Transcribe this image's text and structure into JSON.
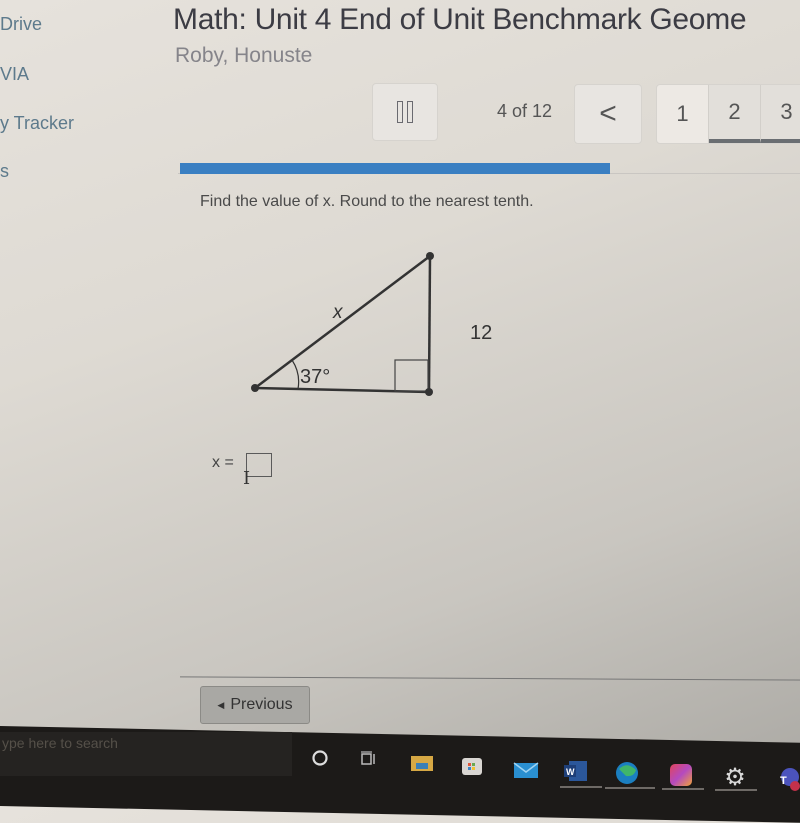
{
  "sidebar": {
    "items": [
      {
        "label": "Drive"
      },
      {
        "label": "VIA"
      },
      {
        "label": "y Tracker"
      },
      {
        "label": "s"
      }
    ]
  },
  "header": {
    "title": "Math: Unit 4 End of Unit Benchmark Geome",
    "student": "Roby, Honuste"
  },
  "toolbar": {
    "pause_icon": "pause-icon",
    "counter": "4 of 12",
    "prev_icon": "chevron-left-icon",
    "prev_glyph": "<",
    "pages": [
      "1",
      "2",
      "3"
    ],
    "current_page": "2"
  },
  "progress": {
    "fraction": 0.333,
    "current": 4,
    "total": 12
  },
  "question": {
    "prompt": "Find the value of x. Round to the nearest tenth.",
    "figure": {
      "hypotenuse_label": "x",
      "opposite_label": "12",
      "angle_label": "37°"
    },
    "answer_label": "x =",
    "answer_value": ""
  },
  "footer": {
    "previous_label": "Previous"
  },
  "taskbar": {
    "search_placeholder": "ype here to search",
    "icons": [
      "cortana-icon",
      "task-view-icon",
      "file-explorer-icon",
      "store-icon",
      "mail-icon",
      "word-icon",
      "edge-icon",
      "creative-cloud-icon",
      "settings-icon",
      "teams-icon"
    ]
  },
  "colors": {
    "accent": "#3a7fc2",
    "sidebar_text": "#5d7a8c"
  }
}
